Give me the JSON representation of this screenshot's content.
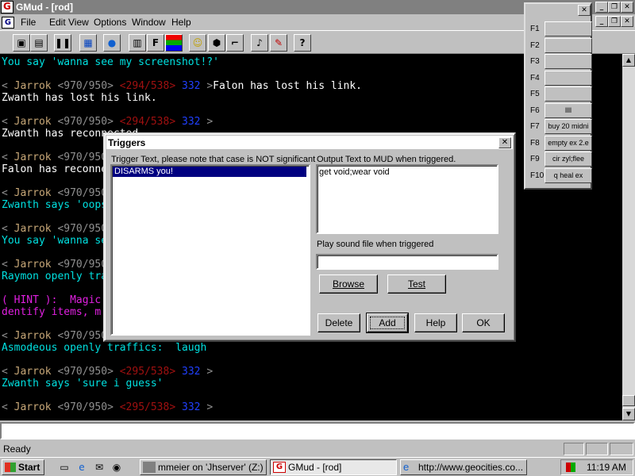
{
  "app": {
    "title": "GMud - [rod]",
    "logo_text": "G"
  },
  "menu": [
    "File",
    "Edit",
    "View",
    "Options",
    "Window",
    "Help"
  ],
  "toolbar_icons": [
    "connect-icon",
    "disconnect-icon",
    "pause-icon",
    "map-icon",
    "globe-icon",
    "notes-icon",
    "font-icon",
    "colors-icon",
    "smiley-icon",
    "dice-icon",
    "gun-icon",
    "sound-icon",
    "pencil-icon",
    "help-icon"
  ],
  "terminal": {
    "lines": [
      [
        {
          "t": "You say 'wanna see my screenshot!?'",
          "c": "cy"
        }
      ],
      [],
      [
        {
          "t": "< ",
          "c": "gr"
        },
        {
          "t": "Jarrok",
          "c": "ye"
        },
        {
          "t": " <970/950> ",
          "c": "gr"
        },
        {
          "t": "<294/538>",
          "c": "rd"
        },
        {
          "t": " 332 ",
          "c": "bl"
        },
        {
          "t": ">",
          "c": "gr"
        },
        {
          "t": "Falon has lost his link.",
          "c": "wh"
        }
      ],
      [
        {
          "t": "Zwanth has lost his link.",
          "c": "wh"
        }
      ],
      [],
      [
        {
          "t": "< ",
          "c": "gr"
        },
        {
          "t": "Jarrok",
          "c": "ye"
        },
        {
          "t": " <970/950> ",
          "c": "gr"
        },
        {
          "t": "<294/538>",
          "c": "rd"
        },
        {
          "t": " 332 ",
          "c": "bl"
        },
        {
          "t": ">",
          "c": "gr"
        }
      ],
      [
        {
          "t": "Zwanth has reconnected.",
          "c": "wh"
        }
      ],
      [],
      [
        {
          "t": "< ",
          "c": "gr"
        },
        {
          "t": "Jarrok",
          "c": "ye"
        },
        {
          "t": " <970/950> ",
          "c": "gr"
        }
      ],
      [
        {
          "t": "Falon has reconnected.",
          "c": "wh"
        }
      ],
      [],
      [
        {
          "t": "< ",
          "c": "gr"
        },
        {
          "t": "Jarrok",
          "c": "ye"
        },
        {
          "t": " <970/950> ",
          "c": "gr"
        }
      ],
      [
        {
          "t": "Zwanth says 'oops'",
          "c": "cy"
        }
      ],
      [],
      [
        {
          "t": "< ",
          "c": "gr"
        },
        {
          "t": "Jarrok",
          "c": "ye"
        },
        {
          "t": " <970/950> ",
          "c": "gr"
        }
      ],
      [
        {
          "t": "You say 'wanna see'",
          "c": "cy"
        }
      ],
      [],
      [
        {
          "t": "< ",
          "c": "gr"
        },
        {
          "t": "Jarrok",
          "c": "ye"
        },
        {
          "t": " <970/950> ",
          "c": "gr"
        }
      ],
      [
        {
          "t": "Raymon openly traffics",
          "c": "cy"
        }
      ],
      [],
      [
        {
          "t": "( HINT ):  Magic",
          "c": "mg"
        }
      ],
      [
        {
          "t": "dentify items, m",
          "c": "mg"
        }
      ],
      [],
      [
        {
          "t": "< ",
          "c": "gr"
        },
        {
          "t": "Jarrok",
          "c": "ye"
        },
        {
          "t": " <970/950> ",
          "c": "gr"
        },
        {
          "t": "<295/538>",
          "c": "rd"
        },
        {
          "t": " 332 ",
          "c": "bl"
        },
        {
          "t": ">",
          "c": "gr"
        }
      ],
      [
        {
          "t": "Asmodeous openly traffics:  laugh",
          "c": "cy"
        }
      ],
      [],
      [
        {
          "t": "< ",
          "c": "gr"
        },
        {
          "t": "Jarrok",
          "c": "ye"
        },
        {
          "t": " <970/950> ",
          "c": "gr"
        },
        {
          "t": "<295/538>",
          "c": "rd"
        },
        {
          "t": " 332 ",
          "c": "bl"
        },
        {
          "t": ">",
          "c": "gr"
        }
      ],
      [
        {
          "t": "Zwanth says 'sure i guess'",
          "c": "cy"
        }
      ],
      [],
      [
        {
          "t": "< ",
          "c": "gr"
        },
        {
          "t": "Jarrok",
          "c": "ye"
        },
        {
          "t": " <970/950> ",
          "c": "gr"
        },
        {
          "t": "<295/538>",
          "c": "rd"
        },
        {
          "t": " 332 ",
          "c": "bl"
        },
        {
          "t": ">",
          "c": "gr"
        }
      ]
    ]
  },
  "status": {
    "text": "Ready"
  },
  "taskbar": {
    "start": "Start",
    "tasks": [
      {
        "label": "mmeier on 'Jhserver' (Z:)",
        "active": false
      },
      {
        "label": "GMud - [rod]",
        "active": true
      },
      {
        "label": "http://www.geocities.co...",
        "active": false
      }
    ],
    "clock": "11:19 AM"
  },
  "triggers_dialog": {
    "title": "Triggers",
    "trigger_label": "Trigger Text, please note that case is NOT significant",
    "triggers": [
      "DISARMS you!"
    ],
    "output_label": "Output Text to MUD when triggered.",
    "output_value": "get void;wear void",
    "sound_label": "Play sound file when triggered",
    "sound_value": "",
    "browse": "Browse",
    "test": "Test",
    "delete": "Delete",
    "add": "Add",
    "help": "Help",
    "ok": "OK"
  },
  "function_keys": [
    {
      "key": "F1",
      "value": ""
    },
    {
      "key": "F2",
      "value": ""
    },
    {
      "key": "F3",
      "value": ""
    },
    {
      "key": "F4",
      "value": ""
    },
    {
      "key": "F5",
      "value": ""
    },
    {
      "key": "F6",
      "value": "llll"
    },
    {
      "key": "F7",
      "value": "buy 20 midni"
    },
    {
      "key": "F8",
      "value": "empty ex 2.e"
    },
    {
      "key": "F9",
      "value": "cir zyl;flee"
    },
    {
      "key": "F10",
      "value": "q heal ex"
    }
  ]
}
